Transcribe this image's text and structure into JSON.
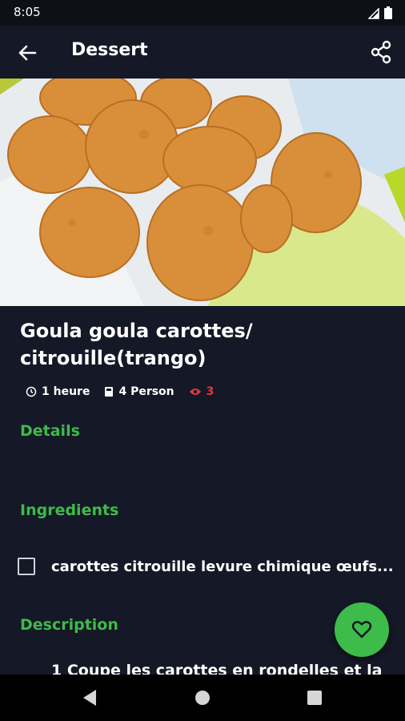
{
  "status": {
    "time": "8:05"
  },
  "app_bar": {
    "title": "Dessert",
    "back_icon": "arrow-left-icon",
    "share_icon": "share-icon"
  },
  "recipe": {
    "title": "Goula goula carottes/ citrouille(trango)",
    "duration": "1 heure",
    "servings": "4 Person",
    "views": "3",
    "image_desc_icon": "food-photo"
  },
  "sections": {
    "details": "Details",
    "ingredients": "Ingredients",
    "description": "Description"
  },
  "ingredients": {
    "text": "carottes  citrouille  levure chimique  œufs..."
  },
  "description": {
    "first_line": "1 Coupe les carottes en rondelles et la"
  },
  "colors": {
    "accent": "#3dbb4b",
    "background": "#151826",
    "views": "#e53935"
  }
}
